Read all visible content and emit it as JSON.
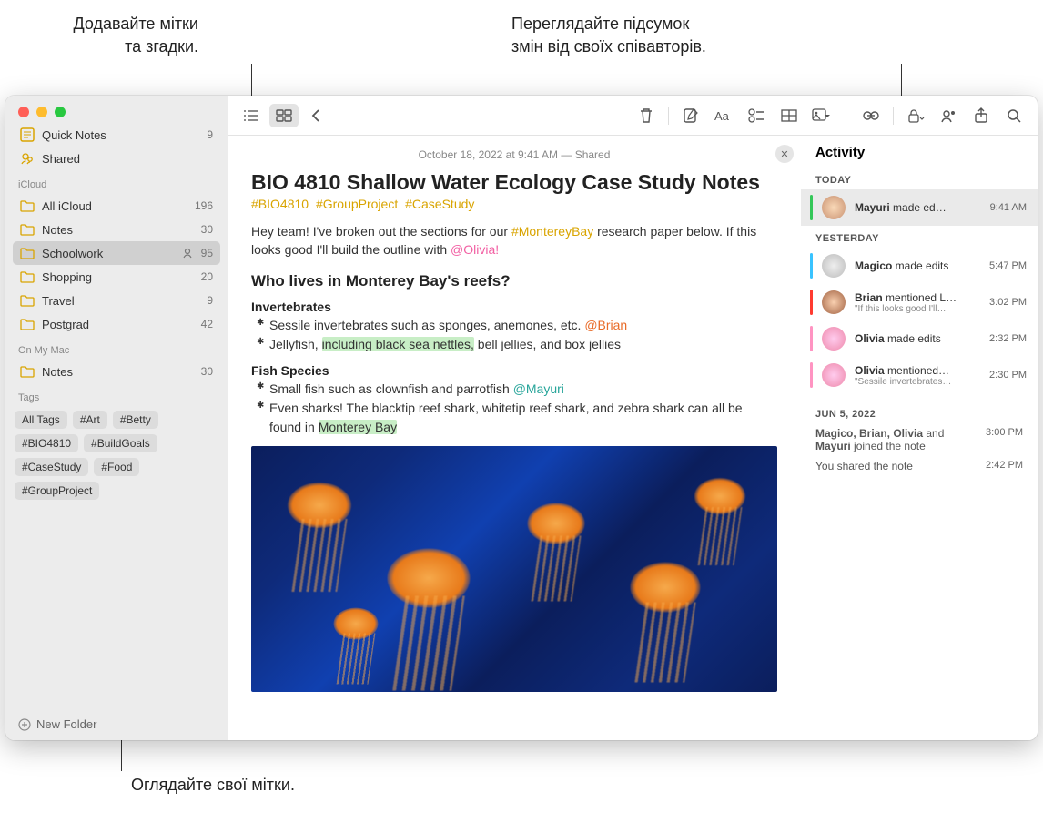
{
  "callouts": {
    "tags_mentions": "Додавайте мітки\nта згадки.",
    "activity_summary": "Переглядайте підсумок\nзмін від своїх співавторів.",
    "browse_tags": "Оглядайте свої мітки."
  },
  "sidebar": {
    "quick_notes": {
      "label": "Quick Notes",
      "count": "9"
    },
    "shared": {
      "label": "Shared"
    },
    "section_icloud": "iCloud",
    "folders_icloud": [
      {
        "label": "All iCloud",
        "count": "196"
      },
      {
        "label": "Notes",
        "count": "30"
      },
      {
        "label": "Schoolwork",
        "count": "95",
        "shared": true,
        "selected": true
      },
      {
        "label": "Shopping",
        "count": "20"
      },
      {
        "label": "Travel",
        "count": "9"
      },
      {
        "label": "Postgrad",
        "count": "42"
      }
    ],
    "section_onmymac": "On My Mac",
    "folders_mac": [
      {
        "label": "Notes",
        "count": "30"
      }
    ],
    "section_tags": "Tags",
    "tags": [
      "All Tags",
      "#Art",
      "#Betty",
      "#BIO4810",
      "#BuildGoals",
      "#CaseStudy",
      "#Food",
      "#GroupProject"
    ],
    "new_folder": "New Folder"
  },
  "note": {
    "meta": "October 18, 2022 at 9:41 AM — Shared",
    "title": "BIO 4810 Shallow Water Ecology Case Study Notes",
    "tags": [
      "#BIO4810",
      "#GroupProject",
      "#CaseStudy"
    ],
    "intro_a": "Hey team! I've broken out the sections for our ",
    "intro_hash": "#MontereyBay",
    "intro_b": " research paper below. If this looks good I'll build the outline with ",
    "intro_mention": "@Olivia!",
    "h2": "Who lives in Monterey Bay's reefs?",
    "sec1_h": "Invertebrates",
    "sec1_b1_a": "Sessile invertebrates such as sponges, anemones, etc. ",
    "sec1_b1_m": "@Brian",
    "sec1_b2_a": "Jellyfish, ",
    "sec1_b2_hl": "including black sea nettles,",
    "sec1_b2_b": " bell jellies, and box jellies",
    "sec2_h": "Fish Species",
    "sec2_b1_a": "Small fish such as clownfish and parrotfish ",
    "sec2_b1_m": "@Mayuri",
    "sec2_b2_a": "Even sharks! The blacktip reef shark, whitetip reef shark, and zebra shark can all be found in ",
    "sec2_b2_hl": "Monterey Bay"
  },
  "activity": {
    "title": "Activity",
    "sections": {
      "today": "TODAY",
      "yesterday": "YESTERDAY",
      "jun5": "JUN 5, 2022"
    },
    "items": {
      "today_1": {
        "who": "Mayuri",
        "rest": " made ed…",
        "time": "9:41 AM",
        "bar": "#34c759",
        "sub": ""
      },
      "y_1": {
        "who": "Magico",
        "rest": " made edits",
        "time": "5:47 PM",
        "bar": "#39c3ff",
        "sub": ""
      },
      "y_2": {
        "who": "Brian",
        "rest": " mentioned L…",
        "time": "3:02 PM",
        "bar": "#ff3b30",
        "sub": "\"If this looks good I'll…"
      },
      "y_3": {
        "who": "Olivia",
        "rest": " made edits",
        "time": "2:32 PM",
        "bar": "#ff94c2",
        "sub": ""
      },
      "y_4": {
        "who": "Olivia",
        "rest": " mentioned…",
        "time": "2:30 PM",
        "bar": "#ff94c2",
        "sub": "\"Sessile invertebrates…"
      }
    },
    "plain": {
      "joined_a": "Magico, Brian, Olivia",
      "joined_b": " and ",
      "joined_c": "Mayuri",
      "joined_d": " joined the note",
      "joined_time": "3:00 PM",
      "shared": "You shared the note",
      "shared_time": "2:42 PM"
    }
  },
  "colors": {
    "accent_yellow": "#d9a400"
  }
}
